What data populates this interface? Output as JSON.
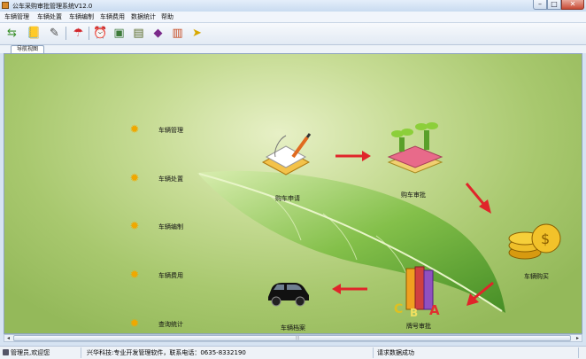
{
  "window": {
    "title": "公车采购审批管理系统V12.0"
  },
  "menu": {
    "items": [
      "车辆管理",
      "车辆处置",
      "车辆编制",
      "车辆费用",
      "数据统计",
      "帮助"
    ]
  },
  "toolbar": {
    "buttons": [
      {
        "name": "exchange-icon",
        "glyph": "⇆"
      },
      {
        "name": "ledger-icon",
        "glyph": "📒"
      },
      {
        "name": "edit-icon",
        "glyph": "✎"
      },
      {
        "name": "umbrella-icon",
        "glyph": "☂"
      },
      {
        "name": "alarm-clock-icon",
        "glyph": "⏰"
      },
      {
        "name": "picture-icon",
        "glyph": "▣"
      },
      {
        "name": "notepad-icon",
        "glyph": "▤"
      },
      {
        "name": "book-icon",
        "glyph": "◆"
      },
      {
        "name": "gift-icon",
        "glyph": "▥"
      },
      {
        "name": "runner-icon",
        "glyph": "➤"
      }
    ]
  },
  "tab": {
    "label": "导航视图"
  },
  "nav": {
    "items": [
      "车辆管理",
      "车辆处置",
      "车辆编制",
      "车辆费用",
      "查询统计"
    ]
  },
  "flow": {
    "purchase_apply": "购车申请",
    "purchase_approve": "购车审批",
    "vehicle_buy": "车辆购买",
    "plate_approve": "牌号审批",
    "vehicle_archive": "车辆档案"
  },
  "scroll": {
    "grip": "⦙⦙⦙"
  },
  "status": {
    "user": "管理员,欢迎您",
    "company": "兴华科技:专业开发管理软件，联系电话：0635-8332190",
    "message": "请求数据成功"
  },
  "colors": {
    "arrow": "#e0252a",
    "leaf": "#6fa93a"
  }
}
